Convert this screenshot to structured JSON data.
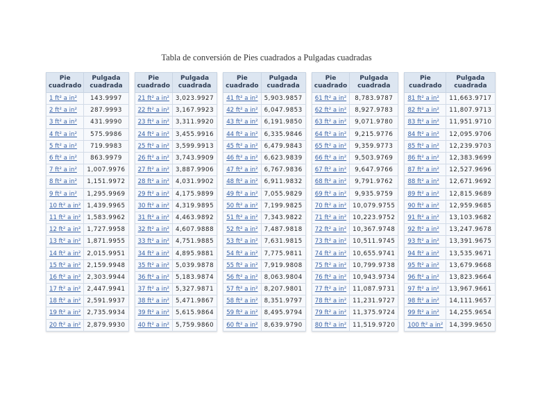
{
  "title": "Tabla de conversión de Pies cuadrados a Pulgadas cuadradas",
  "headers": {
    "col1_line1": "Pie",
    "col1_line2": "cuadrado",
    "col2_line1": "Pulgada",
    "col2_line2": "cuadrada"
  },
  "tables": [
    {
      "rows": [
        {
          "label": "1 ft² a in²",
          "value": "143.9997"
        },
        {
          "label": "2 ft² a in²",
          "value": "287.9993"
        },
        {
          "label": "3 ft² a in²",
          "value": "431.9990"
        },
        {
          "label": "4 ft² a in²",
          "value": "575.9986"
        },
        {
          "label": "5 ft² a in²",
          "value": "719.9983"
        },
        {
          "label": "6 ft² a in²",
          "value": "863.9979"
        },
        {
          "label": "7 ft² a in²",
          "value": "1,007.9976"
        },
        {
          "label": "8 ft² a in²",
          "value": "1,151.9972"
        },
        {
          "label": "9 ft² a in²",
          "value": "1,295.9969"
        },
        {
          "label": "10 ft² a in²",
          "value": "1,439.9965"
        },
        {
          "label": "11 ft² a in²",
          "value": "1,583.9962"
        },
        {
          "label": "12 ft² a in²",
          "value": "1,727.9958"
        },
        {
          "label": "13 ft² a in²",
          "value": "1,871.9955"
        },
        {
          "label": "14 ft² a in²",
          "value": "2,015.9951"
        },
        {
          "label": "15 ft² a in²",
          "value": "2,159.9948"
        },
        {
          "label": "16 ft² a in²",
          "value": "2,303.9944"
        },
        {
          "label": "17 ft² a in²",
          "value": "2,447.9941"
        },
        {
          "label": "18 ft² a in²",
          "value": "2,591.9937"
        },
        {
          "label": "19 ft² a in²",
          "value": "2,735.9934"
        },
        {
          "label": "20 ft² a in²",
          "value": "2,879.9930"
        }
      ]
    },
    {
      "rows": [
        {
          "label": "21 ft² a in²",
          "value": "3,023.9927"
        },
        {
          "label": "22 ft² a in²",
          "value": "3,167.9923"
        },
        {
          "label": "23 ft² a in²",
          "value": "3,311.9920"
        },
        {
          "label": "24 ft² a in²",
          "value": "3,455.9916"
        },
        {
          "label": "25 ft² a in²",
          "value": "3,599.9913"
        },
        {
          "label": "26 ft² a in²",
          "value": "3,743.9909"
        },
        {
          "label": "27 ft² a in²",
          "value": "3,887.9906"
        },
        {
          "label": "28 ft² a in²",
          "value": "4,031.9902"
        },
        {
          "label": "29 ft² a in²",
          "value": "4,175.9899"
        },
        {
          "label": "30 ft² a in²",
          "value": "4,319.9895"
        },
        {
          "label": "31 ft² a in²",
          "value": "4,463.9892"
        },
        {
          "label": "32 ft² a in²",
          "value": "4,607.9888"
        },
        {
          "label": "33 ft² a in²",
          "value": "4,751.9885"
        },
        {
          "label": "34 ft² a in²",
          "value": "4,895.9881"
        },
        {
          "label": "35 ft² a in²",
          "value": "5,039.9878"
        },
        {
          "label": "36 ft² a in²",
          "value": "5,183.9874"
        },
        {
          "label": "37 ft² a in²",
          "value": "5,327.9871"
        },
        {
          "label": "38 ft² a in²",
          "value": "5,471.9867"
        },
        {
          "label": "39 ft² a in²",
          "value": "5,615.9864"
        },
        {
          "label": "40 ft² a in²",
          "value": "5,759.9860"
        }
      ]
    },
    {
      "rows": [
        {
          "label": "41 ft² a in²",
          "value": "5,903.9857"
        },
        {
          "label": "42 ft² a in²",
          "value": "6,047.9853"
        },
        {
          "label": "43 ft² a in²",
          "value": "6,191.9850"
        },
        {
          "label": "44 ft² a in²",
          "value": "6,335.9846"
        },
        {
          "label": "45 ft² a in²",
          "value": "6,479.9843"
        },
        {
          "label": "46 ft² a in²",
          "value": "6,623.9839"
        },
        {
          "label": "47 ft² a in²",
          "value": "6,767.9836"
        },
        {
          "label": "48 ft² a in²",
          "value": "6,911.9832"
        },
        {
          "label": "49 ft² a in²",
          "value": "7,055.9829"
        },
        {
          "label": "50 ft² a in²",
          "value": "7,199.9825"
        },
        {
          "label": "51 ft² a in²",
          "value": "7,343.9822"
        },
        {
          "label": "52 ft² a in²",
          "value": "7,487.9818"
        },
        {
          "label": "53 ft² a in²",
          "value": "7,631.9815"
        },
        {
          "label": "54 ft² a in²",
          "value": "7,775.9811"
        },
        {
          "label": "55 ft² a in²",
          "value": "7,919.9808"
        },
        {
          "label": "56 ft² a in²",
          "value": "8,063.9804"
        },
        {
          "label": "57 ft² a in²",
          "value": "8,207.9801"
        },
        {
          "label": "58 ft² a in²",
          "value": "8,351.9797"
        },
        {
          "label": "59 ft² a in²",
          "value": "8,495.9794"
        },
        {
          "label": "60 ft² a in²",
          "value": "8,639.9790"
        }
      ]
    },
    {
      "rows": [
        {
          "label": "61 ft² a in²",
          "value": "8,783.9787"
        },
        {
          "label": "62 ft² a in²",
          "value": "8,927.9783"
        },
        {
          "label": "63 ft² a in²",
          "value": "9,071.9780"
        },
        {
          "label": "64 ft² a in²",
          "value": "9,215.9776"
        },
        {
          "label": "65 ft² a in²",
          "value": "9,359.9773"
        },
        {
          "label": "66 ft² a in²",
          "value": "9,503.9769"
        },
        {
          "label": "67 ft² a in²",
          "value": "9,647.9766"
        },
        {
          "label": "68 ft² a in²",
          "value": "9,791.9762"
        },
        {
          "label": "69 ft² a in²",
          "value": "9,935.9759"
        },
        {
          "label": "70 ft² a in²",
          "value": "10,079.9755"
        },
        {
          "label": "71 ft² a in²",
          "value": "10,223.9752"
        },
        {
          "label": "72 ft² a in²",
          "value": "10,367.9748"
        },
        {
          "label": "73 ft² a in²",
          "value": "10,511.9745"
        },
        {
          "label": "74 ft² a in²",
          "value": "10,655.9741"
        },
        {
          "label": "75 ft² a in²",
          "value": "10,799.9738"
        },
        {
          "label": "76 ft² a in²",
          "value": "10,943.9734"
        },
        {
          "label": "77 ft² a in²",
          "value": "11,087.9731"
        },
        {
          "label": "78 ft² a in²",
          "value": "11,231.9727"
        },
        {
          "label": "79 ft² a in²",
          "value": "11,375.9724"
        },
        {
          "label": "80 ft² a in²",
          "value": "11,519.9720"
        }
      ]
    },
    {
      "rows": [
        {
          "label": "81 ft² a in²",
          "value": "11,663.9717"
        },
        {
          "label": "82 ft² a in²",
          "value": "11,807.9713"
        },
        {
          "label": "83 ft² a in²",
          "value": "11,951.9710"
        },
        {
          "label": "84 ft² a in²",
          "value": "12,095.9706"
        },
        {
          "label": "85 ft² a in²",
          "value": "12,239.9703"
        },
        {
          "label": "86 ft² a in²",
          "value": "12,383.9699"
        },
        {
          "label": "87 ft² a in²",
          "value": "12,527.9696"
        },
        {
          "label": "88 ft² a in²",
          "value": "12,671.9692"
        },
        {
          "label": "89 ft² a in²",
          "value": "12,815.9689"
        },
        {
          "label": "90 ft² a in²",
          "value": "12,959.9685"
        },
        {
          "label": "91 ft² a in²",
          "value": "13,103.9682"
        },
        {
          "label": "92 ft² a in²",
          "value": "13,247.9678"
        },
        {
          "label": "93 ft² a in²",
          "value": "13,391.9675"
        },
        {
          "label": "94 ft² a in²",
          "value": "13,535.9671"
        },
        {
          "label": "95 ft² a in²",
          "value": "13,679.9668"
        },
        {
          "label": "96 ft² a in²",
          "value": "13,823.9664"
        },
        {
          "label": "97 ft² a in²",
          "value": "13,967.9661"
        },
        {
          "label": "98 ft² a in²",
          "value": "14,111.9657"
        },
        {
          "label": "99 ft² a in²",
          "value": "14,255.9654"
        },
        {
          "label": "100 ft² a in²",
          "value": "14,399.9650"
        }
      ]
    }
  ]
}
